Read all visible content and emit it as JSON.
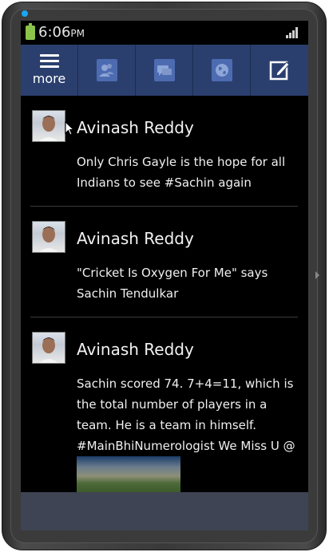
{
  "status_bar": {
    "time": "6:06",
    "ampm": "PM",
    "battery_icon": "battery-icon",
    "signal_icon": "signal-icon",
    "led_color": "#19a6f0"
  },
  "action_bar": {
    "more_label": "more",
    "bg_color": "#2b3f6e",
    "tabs": [
      {
        "icon": "people-icon"
      },
      {
        "icon": "messages-icon"
      },
      {
        "icon": "globe-icon"
      }
    ],
    "compose_icon": "compose-icon"
  },
  "feed": {
    "posts": [
      {
        "author": "Avinash Reddy",
        "text": "Only Chris Gayle is the hope for all Indians to see #Sachin again"
      },
      {
        "author": "Avinash Reddy",
        "text": "\"Cricket Is Oxygen For Me\" says Sachin Tendulkar"
      },
      {
        "author": "Avinash Reddy",
        "text": "Sachin scored 74. 7+4=11, which is the total number of players in a team. He is a team in himself. #MainBhiNumerologist We Miss U @"
      }
    ]
  }
}
